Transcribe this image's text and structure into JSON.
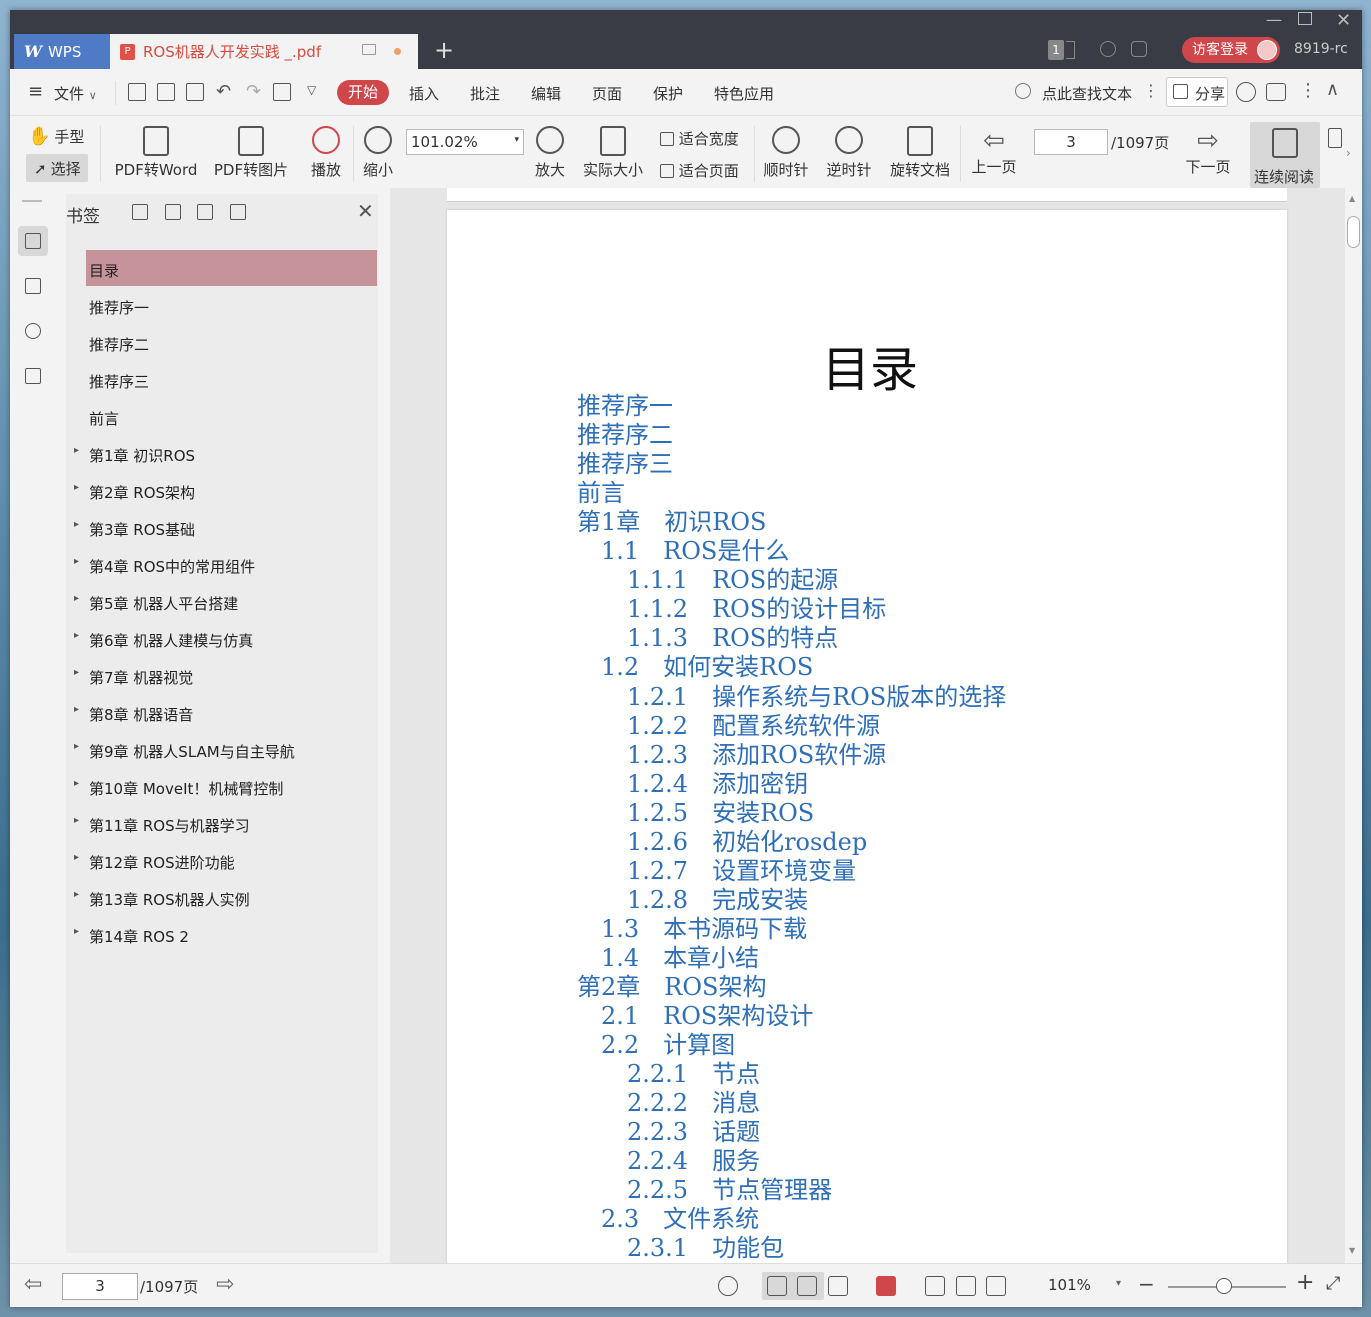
{
  "titlebar": {
    "app": "WPS",
    "doc_tab": "ROS机器人开发实践 _.pdf",
    "login": "访客登录",
    "user": "8919-rc",
    "badge": "1"
  },
  "menubar": {
    "file": "文件",
    "items": [
      "开始",
      "插入",
      "批注",
      "编辑",
      "页面",
      "保护",
      "特色应用"
    ],
    "search": "点此查找文本",
    "share": "分享"
  },
  "toolbar": {
    "hand": "手型",
    "select": "选择",
    "pdf2word": "PDF转Word",
    "pdf2img": "PDF转图片",
    "play": "播放",
    "zoom_out": "缩小",
    "zoom_value": "101.02%",
    "zoom_in": "放大",
    "actual": "实际大小",
    "fit_width": "适合宽度",
    "fit_page": "适合页面",
    "cw": "顺时针",
    "ccw": "逆时针",
    "rotate": "旋转文档",
    "prev": "上一页",
    "page": "3",
    "total": "/1097页",
    "next": "下一页",
    "continuous": "连续阅读"
  },
  "bookmarks": {
    "title": "书签",
    "items": [
      {
        "label": "目录",
        "expand": false
      },
      {
        "label": "推荐序一",
        "expand": false
      },
      {
        "label": "推荐序二",
        "expand": false
      },
      {
        "label": "推荐序三",
        "expand": false
      },
      {
        "label": "前言",
        "expand": false
      },
      {
        "label": "第1章 初识ROS",
        "expand": true
      },
      {
        "label": "第2章 ROS架构",
        "expand": true
      },
      {
        "label": "第3章 ROS基础",
        "expand": true
      },
      {
        "label": "第4章 ROS中的常用组件",
        "expand": true
      },
      {
        "label": "第5章 机器人平台搭建",
        "expand": true
      },
      {
        "label": "第6章 机器人建模与仿真",
        "expand": true
      },
      {
        "label": "第7章 机器视觉",
        "expand": true
      },
      {
        "label": "第8章 机器语音",
        "expand": true
      },
      {
        "label": "第9章 机器人SLAM与自主导航",
        "expand": true
      },
      {
        "label": "第10章 MoveIt！机械臂控制",
        "expand": true
      },
      {
        "label": "第11章 ROS与机器学习",
        "expand": true
      },
      {
        "label": "第12章 ROS进阶功能",
        "expand": true
      },
      {
        "label": "第13章 ROS机器人实例",
        "expand": true
      },
      {
        "label": "第14章 ROS 2",
        "expand": true
      }
    ]
  },
  "document": {
    "title": "目录",
    "toc": [
      {
        "text": "推荐序一",
        "level": 0
      },
      {
        "text": "推荐序二",
        "level": 0
      },
      {
        "text": "推荐序三",
        "level": 0
      },
      {
        "text": "前言",
        "level": 0
      },
      {
        "text": "第1章　初识ROS",
        "level": 0
      },
      {
        "text": "1.1　ROS是什么",
        "level": 1
      },
      {
        "text": "1.1.1　ROS的起源",
        "level": 2
      },
      {
        "text": "1.1.2　ROS的设计目标",
        "level": 2
      },
      {
        "text": "1.1.3　ROS的特点",
        "level": 2
      },
      {
        "text": "1.2　如何安装ROS",
        "level": 1
      },
      {
        "text": "1.2.1　操作系统与ROS版本的选择",
        "level": 2
      },
      {
        "text": "1.2.2　配置系统软件源",
        "level": 2
      },
      {
        "text": "1.2.3　添加ROS软件源",
        "level": 2
      },
      {
        "text": "1.2.4　添加密钥",
        "level": 2
      },
      {
        "text": "1.2.5　安装ROS",
        "level": 2
      },
      {
        "text": "1.2.6　初始化rosdep",
        "level": 2
      },
      {
        "text": "1.2.7　设置环境变量",
        "level": 2
      },
      {
        "text": "1.2.8　完成安装",
        "level": 2
      },
      {
        "text": "1.3　本书源码下载",
        "level": 1
      },
      {
        "text": "1.4　本章小结",
        "level": 1
      },
      {
        "text": "第2章　ROS架构",
        "level": 0
      },
      {
        "text": "2.1　ROS架构设计",
        "level": 1
      },
      {
        "text": "2.2　计算图",
        "level": 1
      },
      {
        "text": "2.2.1　节点",
        "level": 2
      },
      {
        "text": "2.2.2　消息",
        "level": 2
      },
      {
        "text": "2.2.3　话题",
        "level": 2
      },
      {
        "text": "2.2.4　服务",
        "level": 2
      },
      {
        "text": "2.2.5　节点管理器",
        "level": 2
      },
      {
        "text": "2.3　文件系统",
        "level": 1
      },
      {
        "text": "2.3.1　功能包",
        "level": 2
      }
    ]
  },
  "statusbar": {
    "page": "3",
    "total": "/1097页",
    "zoom": "101%"
  },
  "colors": {
    "accent": "#d0474b",
    "link": "#2e6fb7",
    "bookmark_selected": "#c6939a",
    "titlebar": "#393c44"
  }
}
